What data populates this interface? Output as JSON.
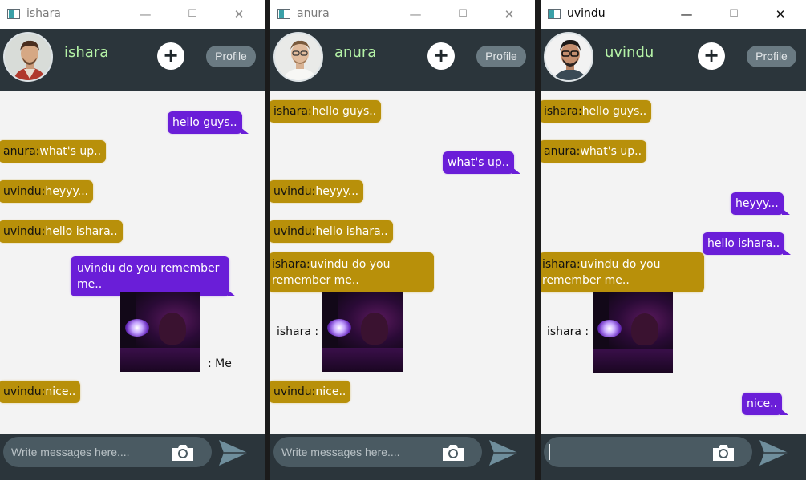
{
  "windows": [
    {
      "title": "ishara",
      "user": "ishara",
      "profile_label": "Profile",
      "add_label": "+",
      "input_placeholder": "Write messages here....",
      "messages": [
        {
          "sender": "",
          "text": "hello guys.."
        },
        {
          "sender": "anura:",
          "text": "what's up.."
        },
        {
          "sender": "uvindu:",
          "text": "heyyy..."
        },
        {
          "sender": "uvindu:",
          "text": "hello ishara.."
        },
        {
          "sender": "",
          "text": "uvindu do you remember me.."
        },
        {
          "sender": "uvindu:",
          "text": "nice.."
        }
      ],
      "image_label": ": Me"
    },
    {
      "title": "anura",
      "user": "anura",
      "profile_label": "Profile",
      "add_label": "+",
      "input_placeholder": "Write messages here....",
      "messages": [
        {
          "sender": "ishara:",
          "text": "hello guys.."
        },
        {
          "sender": "",
          "text": "what's up.."
        },
        {
          "sender": "uvindu:",
          "text": "heyyy..."
        },
        {
          "sender": "uvindu:",
          "text": "hello ishara.."
        },
        {
          "sender": "ishara:",
          "text": "uvindu do you remember me.."
        },
        {
          "sender": "uvindu:",
          "text": "nice.."
        }
      ],
      "image_label": "ishara :"
    },
    {
      "title": "uvindu",
      "user": "uvindu",
      "profile_label": "Profile",
      "add_label": "+",
      "input_placeholder": "",
      "messages": [
        {
          "sender": "ishara:",
          "text": "hello guys.."
        },
        {
          "sender": "anura:",
          "text": "what's up.."
        },
        {
          "sender": "",
          "text": "heyyy..."
        },
        {
          "sender": "",
          "text": "hello ishara.."
        },
        {
          "sender": "ishara:",
          "text": "uvindu do you remember me.."
        },
        {
          "sender": "",
          "text": "nice.."
        }
      ],
      "image_label": "ishara :"
    }
  ],
  "window_controls": {
    "minimize": "—",
    "maximize": "☐",
    "close": "✕"
  },
  "colors": {
    "header_bg": "#2b353b",
    "incoming_bubble": "#b8900a",
    "outgoing_bubble": "#6a1ed8",
    "username": "#b4f2a6",
    "profile_button": "#6a7a82",
    "chat_bg": "#f3f3f3"
  },
  "icons": [
    "app-icon",
    "avatar",
    "plus-icon",
    "camera-icon",
    "send-icon"
  ]
}
